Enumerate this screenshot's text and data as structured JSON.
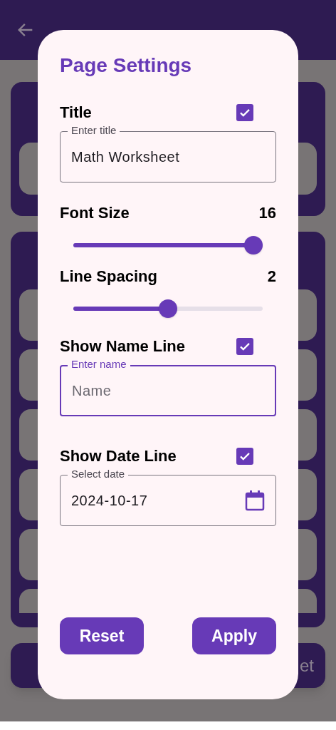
{
  "background": {
    "bottom_bar_text": "et"
  },
  "dialog": {
    "title": "Page Settings",
    "sections": [
      {
        "kind": "checkbox_field",
        "label": "Title",
        "checked": true,
        "field": {
          "label": "Enter title",
          "value": "Math Worksheet",
          "focused": false
        }
      },
      {
        "kind": "slider",
        "label": "Font Size",
        "reading": "16",
        "level": 1
      },
      {
        "kind": "slider",
        "label": "Line Spacing",
        "reading": "2",
        "level": 0.5
      },
      {
        "kind": "checkbox_field",
        "label": "Show Name Line",
        "checked": true,
        "field": {
          "label": "Enter name",
          "placeholder": "Name",
          "focused": true
        }
      },
      {
        "kind": "checkbox_date",
        "label": "Show Date Line",
        "checked": true,
        "field": {
          "label": "Select date",
          "value": "2024-10-17",
          "focused": false
        }
      }
    ],
    "buttons": [
      "Reset",
      "Apply"
    ]
  }
}
